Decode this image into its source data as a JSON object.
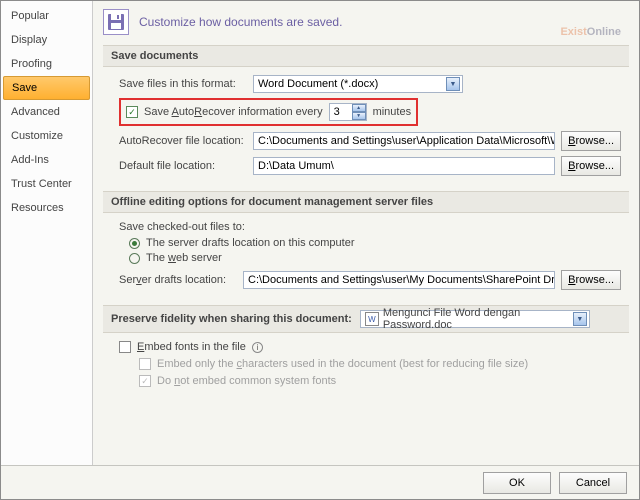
{
  "sidebar": {
    "items": [
      {
        "label": "Popular"
      },
      {
        "label": "Display"
      },
      {
        "label": "Proofing"
      },
      {
        "label": "Save"
      },
      {
        "label": "Advanced"
      },
      {
        "label": "Customize"
      },
      {
        "label": "Add-Ins"
      },
      {
        "label": "Trust Center"
      },
      {
        "label": "Resources"
      }
    ]
  },
  "header": {
    "text": "Customize how documents are saved."
  },
  "watermark": {
    "left": "Exist",
    "right": "Online"
  },
  "section1": {
    "title": "Save documents",
    "format_label": "Save files in this format:",
    "format_value": "Word Document (*.docx)",
    "autorecover_label_pre": "Save ",
    "autorecover_label_u": "A",
    "autorecover_label_mid": "uto",
    "autorecover_label_u2": "R",
    "autorecover_label_post": "ecover information every",
    "autorecover_minutes": "3",
    "minutes_label": "minutes",
    "autorecover_loc_label": "AutoRecover file location:",
    "autorecover_loc_val": "C:\\Documents and Settings\\user\\Application Data\\Microsoft\\Word\\",
    "default_loc_label": "Default file location:",
    "default_loc_val": "D:\\Data Umum\\",
    "browse": "Browse..."
  },
  "section2": {
    "title": "Offline editing options for document management server files",
    "checked_out_label": "Save checked-out files to:",
    "opt1": "The server drafts location on this computer",
    "opt2_pre": "The ",
    "opt2_u": "w",
    "opt2_post": "eb server",
    "drafts_label_pre": "Ser",
    "drafts_label_u": "v",
    "drafts_label_post": "er drafts location:",
    "drafts_val": "C:\\Documents and Settings\\user\\My Documents\\SharePoint Drafts\\",
    "browse": "Browse..."
  },
  "section3": {
    "title": "Preserve fidelity when sharing this document:",
    "doc_name": "Mengunci File Word dengan Password.doc",
    "embed_label_pre": "",
    "embed_label_u": "E",
    "embed_label_post": "mbed fonts in the file",
    "sub1_pre": "Embed only the ",
    "sub1_u": "c",
    "sub1_post": "haracters used in the document (best for reducing file size)",
    "sub2_pre": "Do ",
    "sub2_u": "n",
    "sub2_post": "ot embed common system fonts"
  },
  "footer": {
    "ok": "OK",
    "cancel": "Cancel"
  }
}
